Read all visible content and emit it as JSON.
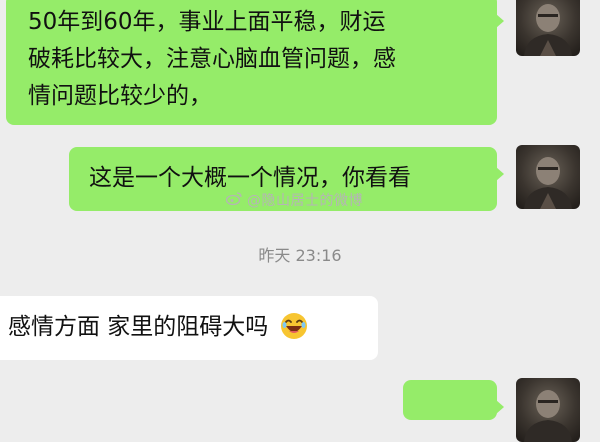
{
  "chat": {
    "messages": [
      {
        "direction": "out",
        "lines": [
          "50年到60年，事业上面平稳，财运",
          "破耗比较大，注意心脑血管问题，感",
          "情问题比较少的，"
        ]
      },
      {
        "direction": "out",
        "text": "这是一个大概一个情况，你看看"
      },
      {
        "direction": "in",
        "text": "感情方面 家里的阻碍大吗",
        "emoji": "laughing-emoji"
      }
    ],
    "timestamp": "昨天 23:16"
  },
  "watermark": {
    "text": "@隐山居士的微博"
  },
  "colors": {
    "background": "#ededed",
    "outgoing_bubble": "#95ec69",
    "incoming_bubble": "#ffffff",
    "timestamp": "#8a8a8a"
  }
}
